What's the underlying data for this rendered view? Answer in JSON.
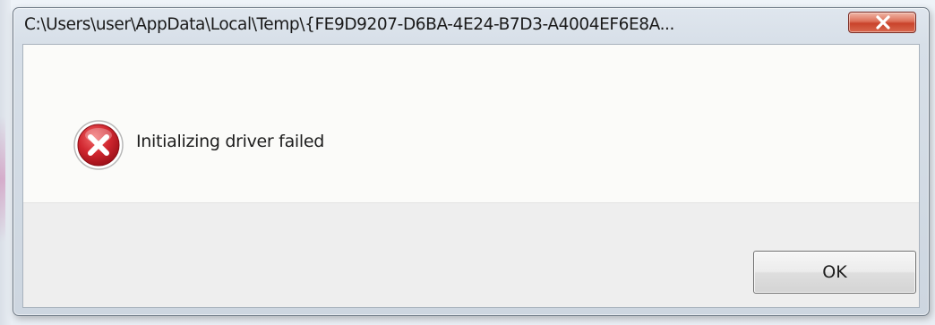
{
  "dialog": {
    "title": "C:\\Users\\user\\AppData\\Local\\Temp\\{FE9D9207-D6BA-4E24-B7D3-A4004EF6E8A...",
    "message": "Initializing driver failed",
    "icon": "error-icon",
    "ok_label": "OK",
    "close_icon": "close-icon"
  },
  "colors": {
    "close_button": "#d0503a",
    "error_icon": "#c8202a"
  }
}
